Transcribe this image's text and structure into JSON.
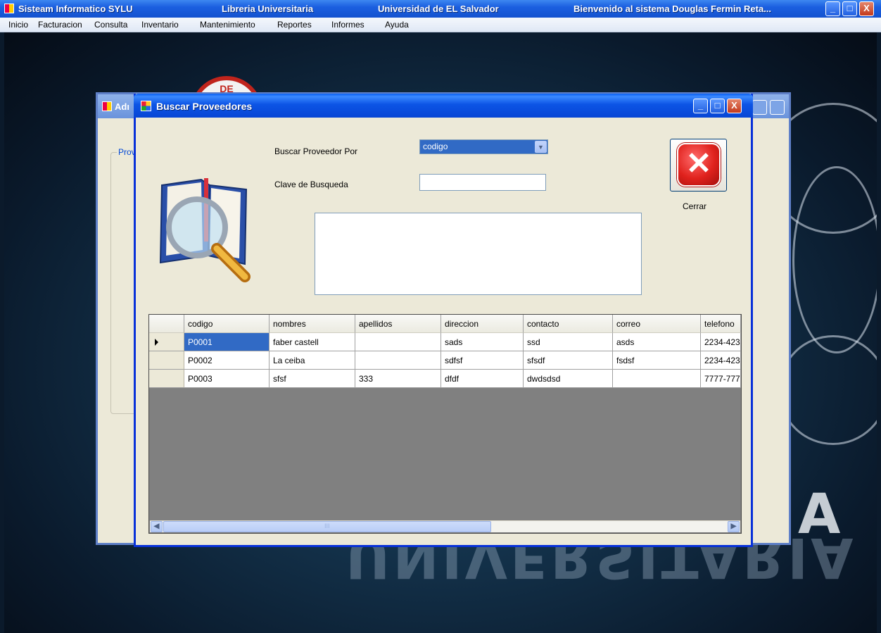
{
  "main_window": {
    "title_parts": [
      "Sisteam Informatico SYLU",
      "Libreria Universitaria",
      "Universidad de EL Salvador",
      "Bienvenido al sistema Douglas Fermin Reta..."
    ],
    "min_label": "_",
    "max_label": "□",
    "close_label": "X"
  },
  "menu": [
    "Inicio",
    "Facturacion",
    "Consulta",
    "Inventario",
    "Mantenimiento",
    "Reportes",
    "Informes",
    "Ayuda"
  ],
  "background_window": {
    "title": "Adı",
    "groupbox_label": "Prov"
  },
  "dialog": {
    "title": "Buscar Proveedores",
    "search_by_label": "Buscar Proveedor Por",
    "search_by_value": "codigo",
    "search_key_label": "Clave de Busqueda",
    "search_key_value": "",
    "close_button_label": "Cerrar"
  },
  "grid": {
    "columns": [
      "codigo",
      "nombres",
      "apellidos",
      "direccion",
      "contacto",
      "correo",
      "telefono"
    ],
    "rows": [
      [
        "P0001",
        "faber castell",
        "",
        "sads",
        "ssd",
        "asds",
        "2234-423"
      ],
      [
        "P0002",
        "La ceiba",
        "",
        "sdfsf",
        "sfsdf",
        "fsdsf",
        "2234-423"
      ],
      [
        "P0003",
        "sfsf",
        "333",
        "dfdf",
        "dwdsdsd",
        "",
        "7777-777"
      ]
    ],
    "selected_row": 0
  },
  "colors": {
    "titlebar_blue": "#0846d5",
    "selection_blue": "#316ac5",
    "dialog_bg": "#ece9d8"
  },
  "background_text": "UNIVERSITARIA"
}
